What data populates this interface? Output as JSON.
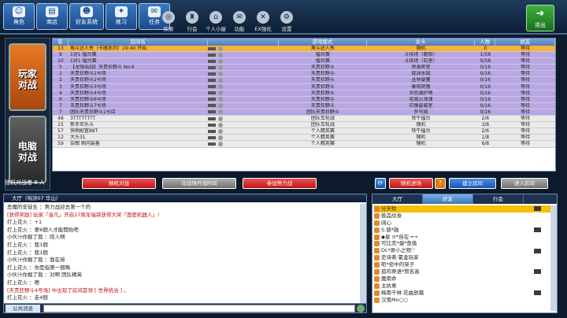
{
  "nav": [
    {
      "label": "角色",
      "icon": "person-icon"
    },
    {
      "label": "商店",
      "icon": "shop-icon"
    },
    {
      "label": "好友系统",
      "icon": "friends-icon"
    },
    {
      "label": "练习",
      "icon": "practice-icon"
    },
    {
      "label": "任务",
      "icon": "task-icon"
    }
  ],
  "tools": [
    {
      "label": "探索",
      "icon": "explore-icon"
    },
    {
      "label": "行会",
      "icon": "guild-icon"
    },
    {
      "label": "个人小屋",
      "icon": "house-icon"
    },
    {
      "label": "功能",
      "icon": "function-icon"
    },
    {
      "label": "EX强化",
      "icon": "ex-icon"
    },
    {
      "label": "设置",
      "icon": "settings-icon"
    }
  ],
  "exit_label": "退出",
  "modes": {
    "user": "玩家\n对战",
    "cpu": "电脑\n对战"
  },
  "table": {
    "headers": [
      "名",
      "房间名",
      "游戏模式",
      "关卡",
      "人数",
      "状态"
    ],
    "rows": [
      {
        "no": "13",
        "name": "角斗达人秀（卡路系列）19:40 开始",
        "mode": "角斗达人秀",
        "stage": "随机",
        "count": "0",
        "status": "等待",
        "kind": "sel"
      },
      {
        "no": "9",
        "name": "1对1 擂台赛",
        "mode": "擂台赛",
        "stage": "斗技场（朝阳）",
        "count": "1/58",
        "status": "等待",
        "kind": "user"
      },
      {
        "no": "10",
        "name": "1对1 擂台赛",
        "mode": "擂台赛",
        "stage": "斗技场（石室）",
        "count": "0/58",
        "status": "等待",
        "kind": "user"
      },
      {
        "no": "5",
        "name": "【龙骑出战】天贵狂野斗 No.6",
        "mode": "天贵狂野斗",
        "stage": "黑溪密室",
        "count": "0/16",
        "status": "等待",
        "kind": "user"
      },
      {
        "no": "1",
        "name": "天贵狂野斗1号场",
        "mode": "天贵狂野斗",
        "stage": "旋涡水城",
        "count": "0/16",
        "status": "等待",
        "kind": "user"
      },
      {
        "no": "2",
        "name": "天贵狂野斗2号场",
        "mode": "天贵狂野斗",
        "stage": "丛林要塞",
        "count": "0/16",
        "status": "等待",
        "kind": "user"
      },
      {
        "no": "3",
        "name": "天贵狂野斗3号场",
        "mode": "天贵狂野斗",
        "stage": "秦阳院落",
        "count": "0/16",
        "status": "等待",
        "kind": "user"
      },
      {
        "no": "4",
        "name": "天贵狂野斗4号场",
        "mode": "天贵狂野斗",
        "stage": "炎热潮护哨",
        "count": "0/16",
        "status": "等待",
        "kind": "user"
      },
      {
        "no": "6",
        "name": "天贵狂野斗6号场",
        "mode": "天贵狂野斗",
        "stage": "花城火海浦",
        "count": "0/16",
        "status": "等待",
        "kind": "user"
      },
      {
        "no": "7",
        "name": "天贵狂野斗7号场",
        "mode": "天贵狂野斗",
        "stage": "巨像要威室",
        "count": "0/16",
        "status": "等待",
        "kind": "user"
      },
      {
        "no": "7",
        "name": "团队天贵狂野斗1号店",
        "mode": "团队天贵狂野斗",
        "stage": "罗马城",
        "count": "0/16",
        "status": "等待",
        "kind": "user"
      },
      {
        "no": "48",
        "name": "3TTTTTTTT",
        "mode": "团队车轮战",
        "stage": "铁牛擂台",
        "count": "2/6",
        "status": "等待",
        "kind": "cpu"
      },
      {
        "no": "15",
        "name": "新手欢乐斗",
        "mode": "团队车轮战",
        "stage": "随机",
        "count": "3/8",
        "status": "等待",
        "kind": "cpu"
      },
      {
        "no": "57",
        "name": "快刷配置88T",
        "mode": "个人精英赛",
        "stage": "铁牛擂台",
        "count": "2/6",
        "status": "等待",
        "kind": "cpu"
      },
      {
        "no": "12",
        "name": "大头31",
        "mode": "个人精英赛",
        "stage": "随机",
        "count": "1/8",
        "status": "等待",
        "kind": "cpu"
      },
      {
        "no": "59",
        "name": "杂图 刷问装备",
        "mode": "个人精英赛",
        "stage": "随机",
        "count": "6/8",
        "status": "等待",
        "kind": "cpu"
      }
    ]
  },
  "bottombar": {
    "opponents": "随机对战者 8 人",
    "random_battle": "随机对战",
    "filter": "非战场开战时间",
    "join_force": "参加势力战",
    "random_enter": "随机进场",
    "help": "?",
    "create_room": "建立房间",
    "enter_room": "进入房间"
  },
  "chat": {
    "title": "大厅（响洪07 华山）",
    "lines": [
      {
        "text": "恶魔的安徒生 ：势力战迎总第一个的",
        "red": false
      },
      {
        "text": "[获得奖励] 玩家「音凡」开启17周年福袋获得大奖「面壁机器人」!",
        "red": true
      },
      {
        "text": "打上花火 ：+1",
        "red": false
      },
      {
        "text": "打上花火 ：要6個人才能開始吧",
        "red": false
      },
      {
        "text": "小伙汁你掘了我 ：陪人啊",
        "red": false
      },
      {
        "text": "打上花火 ：我1個",
        "red": false
      },
      {
        "text": "打上花火 ：我1個",
        "red": false
      },
      {
        "text": "小伙汁你掘了我 ：我在排",
        "red": false
      },
      {
        "text": "打上花火 ：你是指第一個嗎",
        "red": false
      },
      {
        "text": "小伙汁你掘了我 ：对啊 团队精英",
        "red": false
      },
      {
        "text": "打上花火 ：嗯",
        "red": false
      },
      {
        "text": "[天贵狂野斗4号场] 中出现了房间首领 [ 世界统治 ] 。",
        "red": true
      },
      {
        "text": "打上花火 ：走4個",
        "red": false
      }
    ],
    "channel": "公共消息"
  },
  "friends": {
    "tabs": [
      "大厅",
      "好友",
      "行会"
    ],
    "list": [
      "分天牧",
      "极品纹身",
      "阔心",
      "S.感*融",
      "◆星 ≡*自在→→",
      "可比克*蛋*鱼极",
      "Dc*渺小之物♡",
      "史诗斋·氯金玩家",
      "呃*密中的架子",
      "孤鸡寄语*默名高",
      "魔南命",
      "主执意",
      "梅南千林 花曲放霜",
      "汉鬼Mo○○"
    ]
  },
  "colors": {
    "selected_row": "#f7b03a",
    "user_row": "#b9a6e6",
    "cpu_row": "#eaeaea"
  }
}
